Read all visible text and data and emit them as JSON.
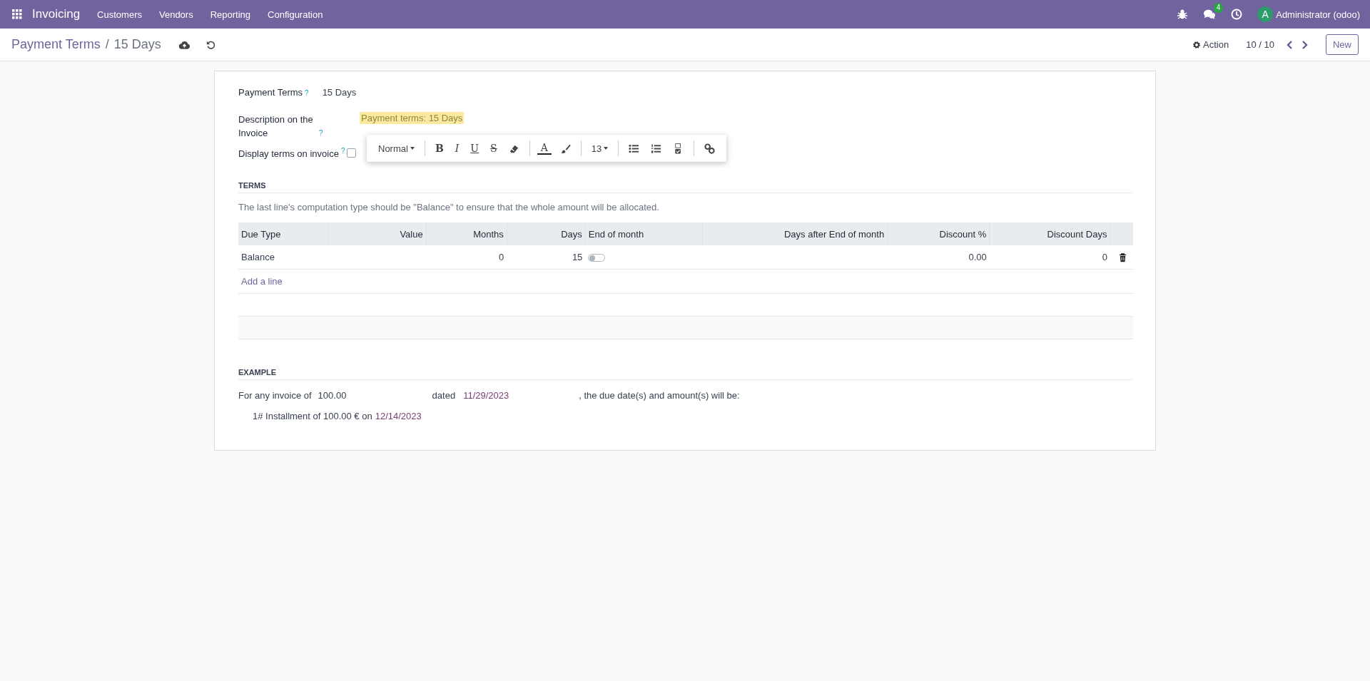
{
  "navbar": {
    "app_name": "Invoicing",
    "menu": [
      "Customers",
      "Vendors",
      "Reporting",
      "Configuration"
    ],
    "messages_badge": "4",
    "avatar_letter": "A",
    "user": "Administrator (odoo)"
  },
  "control_panel": {
    "breadcrumb_parent": "Payment Terms",
    "breadcrumb_separator": "/",
    "breadcrumb_current": "15 Days",
    "action": "Action",
    "pager": "10 / 10",
    "new_button": "New"
  },
  "form": {
    "name_label": "Payment Terms",
    "name_help": "?",
    "name_value": "15 Days",
    "description_label": "Description on the Invoice",
    "description_help": "?",
    "description_value": "Payment terms: 15 Days",
    "display_label": "Display terms on invoice",
    "display_help": "?",
    "display_checked": false
  },
  "toolbar": {
    "groups": [
      [
        {
          "kind": "dropdown",
          "label": "Normal"
        }
      ],
      [
        {
          "kind": "bold",
          "label": "B"
        },
        {
          "kind": "italic",
          "label": "I"
        },
        {
          "kind": "underline",
          "label": "U"
        },
        {
          "kind": "strike",
          "label": "S"
        },
        {
          "kind": "eraser"
        }
      ],
      [
        {
          "kind": "text-color",
          "label": "A"
        },
        {
          "kind": "brush"
        }
      ],
      [
        {
          "kind": "dropdown",
          "label": "13"
        }
      ],
      [
        {
          "kind": "bullets"
        },
        {
          "kind": "numbers"
        },
        {
          "kind": "checklist"
        }
      ],
      [
        {
          "kind": "link"
        }
      ]
    ]
  },
  "terms": {
    "heading": "TERMS",
    "hint": "The last line's computation type should be \"Balance\" to ensure that the whole amount will be allocated.",
    "columns": [
      "Due Type",
      "Value",
      "Months",
      "Days",
      "End of month",
      "Days after End of month",
      "Discount %",
      "Discount Days"
    ],
    "rows": [
      {
        "due_type": "Balance",
        "months": "0",
        "days": "15",
        "end_of_month": false,
        "discount": "0.00",
        "discount_days": "0"
      }
    ],
    "add_line": "Add a line"
  },
  "example": {
    "heading": "EXAMPLE",
    "prefix": "For any invoice of",
    "amount": "100.00",
    "dated": "dated",
    "date": "11/29/2023",
    "suffix": ", the due date(s) and amount(s) will be:",
    "installments": [
      {
        "text": "1# Installment of 100.00 € on",
        "date": "12/14/2023"
      }
    ]
  }
}
